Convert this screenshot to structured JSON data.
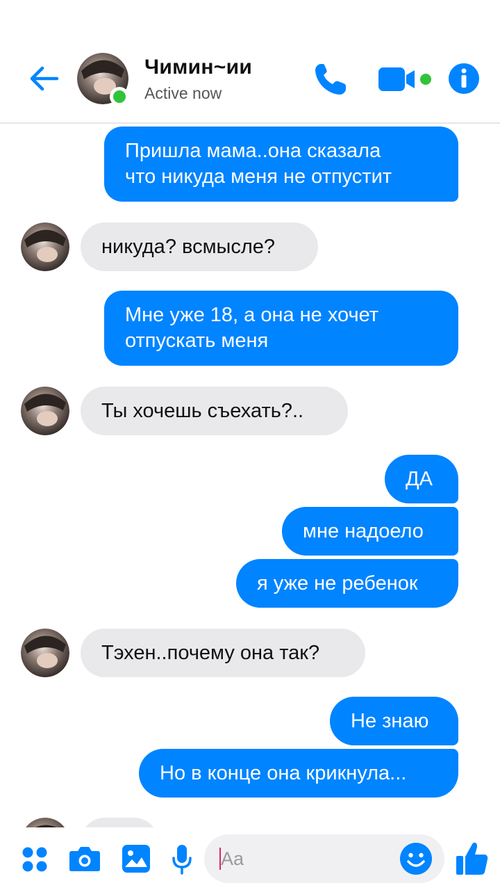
{
  "header": {
    "contact_name": "Чимин~ии",
    "status": "Active now"
  },
  "messages": [
    {
      "from": "me",
      "text": "Пришла мама..она сказала\nчто никуда меня не отпустит"
    },
    {
      "from": "contact",
      "text": "никуда? всмысле?"
    },
    {
      "from": "me",
      "text": "Мне уже 18, а она не хочет\nотпускать меня"
    },
    {
      "from": "contact",
      "text": "Ты хочешь съехать?.."
    },
    {
      "from": "me",
      "text": "ДА"
    },
    {
      "from": "me",
      "text": "мне надоело"
    },
    {
      "from": "me",
      "text": "я уже не ребенок"
    },
    {
      "from": "contact",
      "text": "Тэхен..почему она так?"
    },
    {
      "from": "me",
      "text": "Не знаю"
    },
    {
      "from": "me",
      "text": "Но в конце она крикнула..."
    }
  ],
  "composer": {
    "placeholder": "Aa"
  },
  "colors": {
    "accent": "#0084ff",
    "incoming_bubble": "#e9e9eb",
    "online": "#31c43b"
  },
  "icons": [
    "back-arrow-icon",
    "phone-icon",
    "video-camera-icon",
    "info-icon",
    "apps-grid-icon",
    "camera-icon",
    "image-icon",
    "microphone-icon",
    "emoji-icon",
    "thumbs-up-icon"
  ]
}
